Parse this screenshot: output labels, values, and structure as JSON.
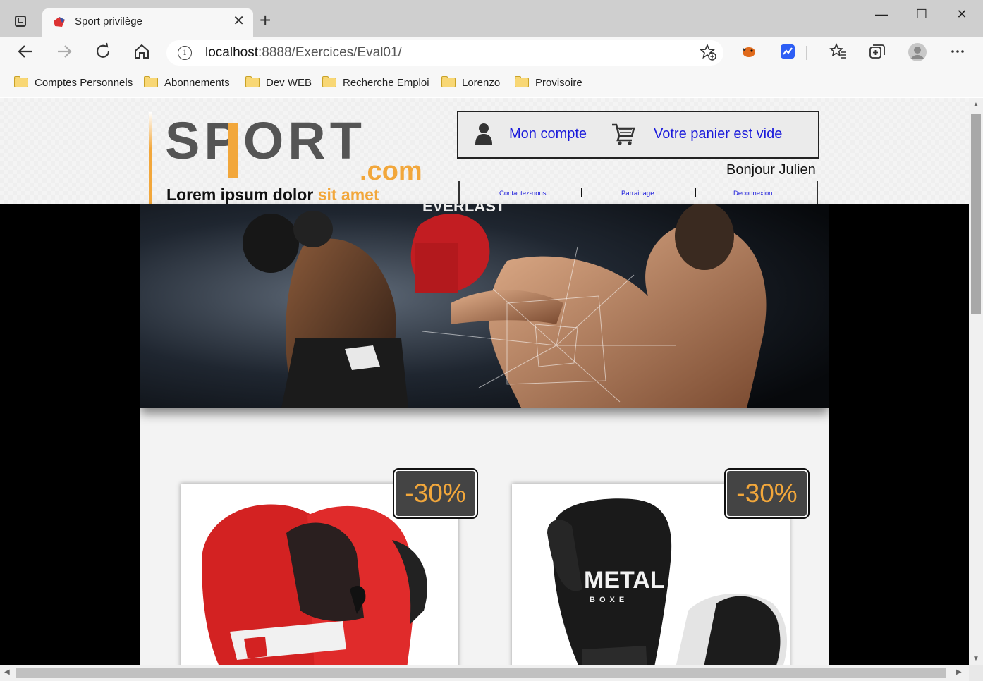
{
  "browser": {
    "tab_title": "Sport privilège",
    "tab_close": "✕",
    "new_tab": "+",
    "window": {
      "minimize": "—",
      "maximize": "☐",
      "close": "✕"
    },
    "url_host": "localhost",
    "url_path": ":8888/Exercices/Eval01/",
    "bookmarks": [
      "Comptes Personnels",
      "Abonnements",
      "Dev WEB",
      "Recherche Emploi",
      "Lorenzo",
      "Provisoire"
    ]
  },
  "site": {
    "logo_text": "SPORT",
    "logo_suffix": ".com",
    "slogan_main": "Lorem ipsum dolor",
    "slogan_accent": "sit amet",
    "account_label": "Mon compte",
    "cart_label": "Votre panier est vide",
    "greeting": "Bonjour Julien",
    "links": [
      "Contactez-nous",
      "Parrainage",
      "Deconnexion"
    ],
    "accent_color": "#f2a73b",
    "link_color": "#1a1adb"
  },
  "products": [
    {
      "name": "red-boxing-gloves",
      "badge": "-30%",
      "color": "#d32222"
    },
    {
      "name": "black-metal-boxe-gloves",
      "badge": "-30%",
      "color": "#1a1a1a",
      "brand": "METAL",
      "brand_sub": "BOXE"
    }
  ]
}
